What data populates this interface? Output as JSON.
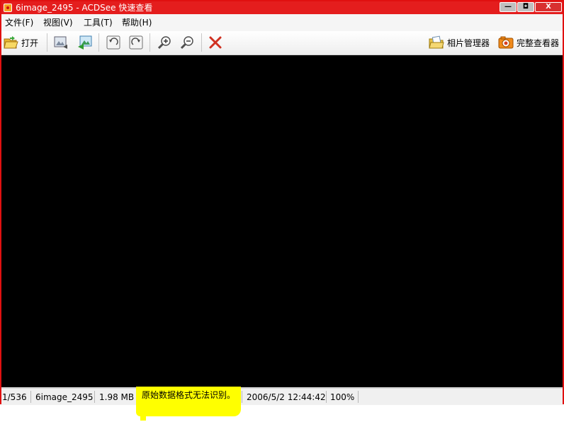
{
  "window": {
    "title": "6image_2495 - ACDSee 快速查看",
    "controls": {
      "minimize": "—",
      "maximize": "◘",
      "close": "X"
    }
  },
  "menu": [
    "文件(F)",
    "视图(V)",
    "工具(T)",
    "帮助(H)"
  ],
  "toolbar": {
    "open_label": "打开",
    "photo_manager_label": "相片管理器",
    "full_viewer_label": "完整查看器"
  },
  "status": {
    "position": "1/536",
    "filename": "6image_2495",
    "filesize": "1.98 MB",
    "message": "原始数据格式无法识别。",
    "datetime": "2006/5/2 12:44:42",
    "zoom": "100%"
  },
  "colors": {
    "titlebar": "#e41d1d",
    "viewer_background": "#000000",
    "highlight": "#ffff00",
    "delete_icon": "#d03020"
  }
}
